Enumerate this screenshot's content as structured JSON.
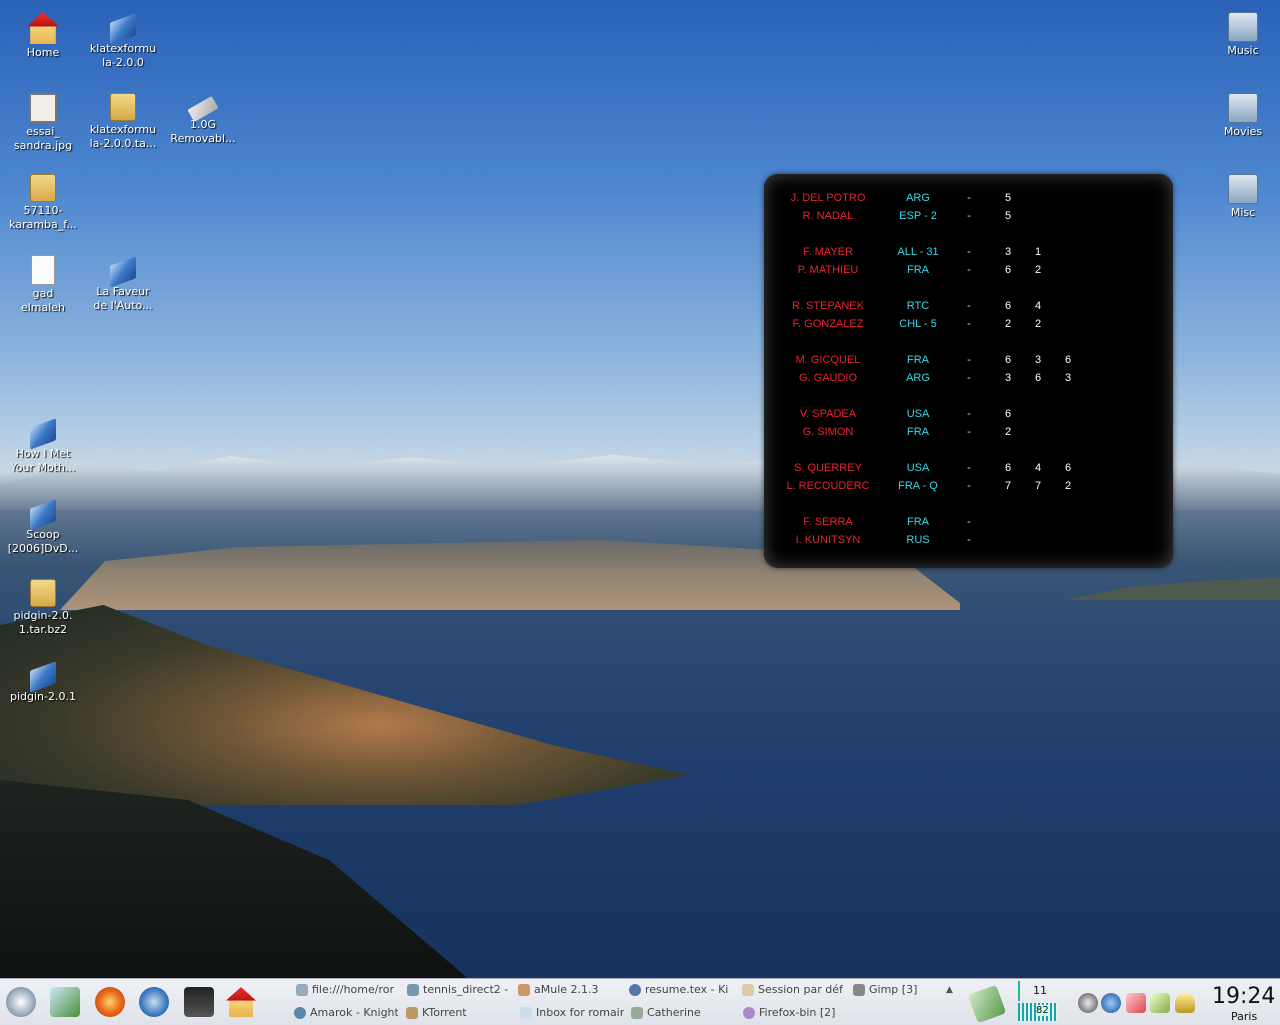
{
  "desktop": {
    "icons": [
      {
        "label_l1": "Home",
        "label_l2": "",
        "kind": "home-icon"
      },
      {
        "label_l1": "klatexformu",
        "label_l2": "la-2.0.0",
        "kind": "book-icon"
      },
      {
        "label_l1": "essai_",
        "label_l2": "sandra.jpg",
        "kind": "image-file-icon"
      },
      {
        "label_l1": "klatexformu",
        "label_l2": "la-2.0.0.ta...",
        "kind": "archive-icon"
      },
      {
        "label_l1": "1.0G",
        "label_l2": "Removabl...",
        "kind": "usb-drive-icon"
      },
      {
        "label_l1": "57110-",
        "label_l2": "karamba_f...",
        "kind": "archive-icon"
      },
      {
        "label_l1": "gad",
        "label_l2": "elmaleh",
        "kind": "document-icon"
      },
      {
        "label_l1": "La Faveur",
        "label_l2": "de l'Auto...",
        "kind": "book-icon"
      },
      {
        "label_l1": "How I Met",
        "label_l2": "Your Moth...",
        "kind": "book-icon"
      },
      {
        "label_l1": "Scoop",
        "label_l2": "[2006]DvD...",
        "kind": "book-icon"
      },
      {
        "label_l1": "pidgin-2.0.",
        "label_l2": "1.tar.bz2",
        "kind": "archive-icon"
      },
      {
        "label_l1": "pidgin-2.0.1",
        "label_l2": "",
        "kind": "book-icon"
      },
      {
        "label_l1": "Music",
        "label_l2": "",
        "kind": "drive-icon"
      },
      {
        "label_l1": "Movies",
        "label_l2": "",
        "kind": "drive-icon"
      },
      {
        "label_l1": "Misc",
        "label_l2": "",
        "kind": "drive-icon"
      }
    ]
  },
  "score_widget": {
    "matches": [
      {
        "p1": {
          "name": "J. DEL POTRO",
          "country": "ARG",
          "dash": "-",
          "s1": "5",
          "s2": "",
          "s3": ""
        },
        "p2": {
          "name": "R. NADAL",
          "country": "ESP - 2",
          "dash": "-",
          "s1": "5",
          "s2": "",
          "s3": ""
        }
      },
      {
        "p1": {
          "name": "F. MAYER",
          "country": "ALL - 31",
          "dash": "-",
          "s1": "3",
          "s2": "1",
          "s3": ""
        },
        "p2": {
          "name": "P. MATHIEU",
          "country": "FRA",
          "dash": "-",
          "s1": "6",
          "s2": "2",
          "s3": ""
        }
      },
      {
        "p1": {
          "name": "R. STEPANEK",
          "country": "RTC",
          "dash": "-",
          "s1": "6",
          "s2": "4",
          "s3": ""
        },
        "p2": {
          "name": "F. GONZALEZ",
          "country": "CHL - 5",
          "dash": "-",
          "s1": "2",
          "s2": "2",
          "s3": ""
        }
      },
      {
        "p1": {
          "name": "M. GICQUEL",
          "country": "FRA",
          "dash": "-",
          "s1": "6",
          "s2": "3",
          "s3": "6"
        },
        "p2": {
          "name": "G. GAUDIO",
          "country": "ARG",
          "dash": "-",
          "s1": "3",
          "s2": "6",
          "s3": "3"
        }
      },
      {
        "p1": {
          "name": "V. SPADEA",
          "country": "USA",
          "dash": "-",
          "s1": "6",
          "s2": "",
          "s3": ""
        },
        "p2": {
          "name": "G. SIMON",
          "country": "FRA",
          "dash": "-",
          "s1": "2",
          "s2": "",
          "s3": ""
        }
      },
      {
        "p1": {
          "name": "S. QUERREY",
          "country": "USA",
          "dash": "-",
          "s1": "6",
          "s2": "4",
          "s3": "6"
        },
        "p2": {
          "name": "L. RECOUDERC",
          "country": "FRA - Q",
          "dash": "-",
          "s1": "7",
          "s2": "7",
          "s3": "2"
        }
      },
      {
        "p1": {
          "name": "F. SERRA",
          "country": "FRA",
          "dash": "-",
          "s1": "",
          "s2": "",
          "s3": ""
        },
        "p2": {
          "name": "I. KUNITSYN",
          "country": "RUS",
          "dash": "-",
          "s1": "",
          "s2": "",
          "s3": ""
        }
      }
    ]
  },
  "taskbar": {
    "tasks_row1": [
      "file:///home/ror",
      "tennis_direct2 -",
      "aMule 2.1.3",
      "resume.tex - Ki",
      "Session par déf",
      "Gimp [3]"
    ],
    "tasks_row2": [
      "Amarok - Knight",
      "KTorrent",
      "Inbox for romain",
      "Catherine",
      "Firefox-bin [2]"
    ],
    "pager_top": "11",
    "pager_bottom": "82",
    "clock": "19:24",
    "timezone": "Paris"
  },
  "colors": {
    "player_name": "#e8232d",
    "country": "#3ad7e6",
    "score": "#ffffff",
    "widget_bg": "#000000"
  }
}
